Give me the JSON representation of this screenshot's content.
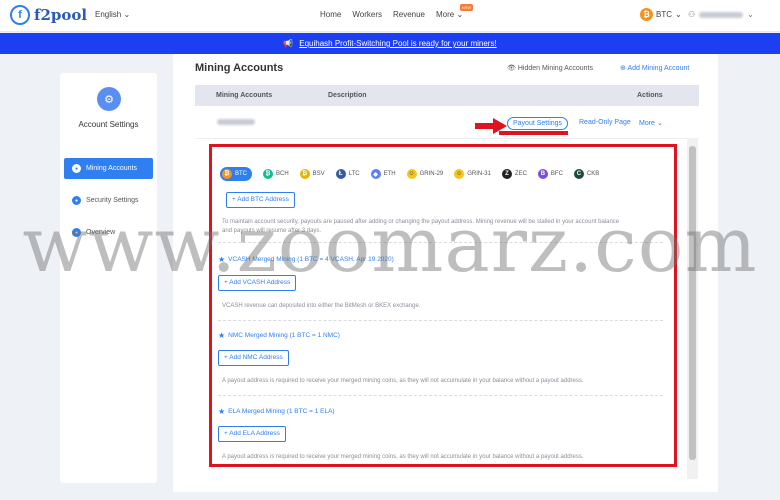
{
  "nav": {
    "logo": "f2pool",
    "language": "English",
    "items": [
      {
        "label": "Home"
      },
      {
        "label": "Workers"
      },
      {
        "label": "Revenue"
      },
      {
        "label": "More"
      }
    ],
    "more_badge": "NEW",
    "coin": "BTC"
  },
  "banner": {
    "text": "Equihash Profit-Switching Pool is ready for your miners!"
  },
  "sidebar": {
    "title": "Account Settings",
    "items": [
      {
        "label": "Mining Accounts"
      },
      {
        "label": "Security Settings"
      },
      {
        "label": "Overview"
      }
    ]
  },
  "main": {
    "title": "Mining Accounts",
    "hidden_link": "Hidden Mining Accounts",
    "add_link": "Add Mining Account",
    "table": {
      "col_account": "Mining Accounts",
      "col_description": "Description",
      "col_actions": "Actions"
    },
    "row": {
      "payout": "Payout Settings",
      "readonly": "Read-Only Page",
      "more": "More"
    }
  },
  "coins": [
    {
      "name": "BTC",
      "color": "#f7931a",
      "glyph": "₿"
    },
    {
      "name": "BCH",
      "color": "#0ac18e",
      "glyph": "₿"
    },
    {
      "name": "BSV",
      "color": "#eab300",
      "glyph": "₿"
    },
    {
      "name": "LTC",
      "color": "#345d9d",
      "glyph": "Ł"
    },
    {
      "name": "ETH",
      "color": "#627eea",
      "glyph": "◆"
    },
    {
      "name": "GRIN-29",
      "color": "#f5c518",
      "glyph": "☺"
    },
    {
      "name": "GRIN-31",
      "color": "#f5c518",
      "glyph": "☺"
    },
    {
      "name": "ZEC",
      "color": "#222222",
      "glyph": "Z"
    },
    {
      "name": "BFC",
      "color": "#7b4dd8",
      "glyph": "B"
    },
    {
      "name": "CKB",
      "color": "#1f4b3a",
      "glyph": "C"
    }
  ],
  "payout": {
    "btc_add": "+ Add BTC Address",
    "btc_note1": "To maintain account security, payouts are paused after adding or changing the payout address. Mining revenue will be stalled in your account balance",
    "btc_note2": "and payouts will resume after 3 days.",
    "vcash_title": "VCASH Merged Mining (1 BTC = 4 VCASH, Apr 19 2020)",
    "vcash_add": "+ Add VCASH Address",
    "vcash_note": "VCASH revenue can deposited into either the BitMesh or BKEX exchange.",
    "nmc_title": "NMC Merged Mining (1 BTC = 1 NMC)",
    "nmc_add": "+ Add NMC Address",
    "nmc_note": "A payout address is required to receive your merged mining coins, as they will not accumulate in your balance without a payout address.",
    "ela_title": "ELA Merged Mining (1 BTC = 1 ELA)",
    "ela_add": "+ Add ELA Address",
    "ela_note": "A payout address is required to receive your merged mining coins, as they will not accumulate in your balance without a payout address."
  },
  "watermark": "www.zoomarz.com",
  "colors": {
    "accent": "#2f7ff0",
    "banner": "#1c3ff3",
    "highlight": "#e0141e"
  }
}
